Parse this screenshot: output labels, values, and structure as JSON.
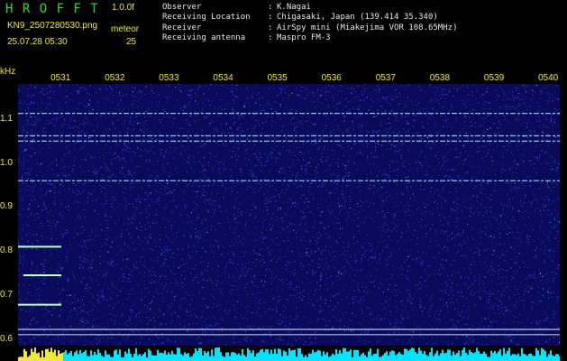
{
  "header": {
    "app_name": "H R O F F T",
    "version": "1.0.0f",
    "filename": "KN9_2507280530.png",
    "datetime": "25.07.28 05:30",
    "meteor_label": "meteor",
    "meteor_count": "25",
    "info": [
      {
        "key": "Observer",
        "value": "K.Nagai"
      },
      {
        "key": "Receiving Location",
        "value": "Chigasaki, Japan (139.414 35.340)"
      },
      {
        "key": "Receiver",
        "value": "AirSpy mini (Miakejima VOR 108.65MHz)"
      },
      {
        "key": "Receiving antenna",
        "value": "Maspro FM-3"
      }
    ]
  },
  "colors": {
    "background": "#000000",
    "plot_background": "#0a0a5a",
    "noise": "#3a5cff",
    "signal": "#9fe6ff",
    "header_green": "#3ad23a",
    "label_yellow": "#f0e83a",
    "strip_cyan": "#00e5ff"
  },
  "chart_data": {
    "type": "heatmap",
    "ylabel": "kHz",
    "y_ticks": [
      "1.1",
      "1.0",
      "0.9",
      "0.8",
      "0.7",
      "0.6"
    ],
    "x_ticks": [
      "0531",
      "0532",
      "0533",
      "0534",
      "0535",
      "0536",
      "0537",
      "0538",
      "0539",
      "0540"
    ],
    "x_range": [
      "0530",
      "0540"
    ],
    "y_range": [
      0.585,
      1.18
    ],
    "carriers_khz": [
      1.113,
      1.062,
      1.05,
      0.96,
      0.622,
      0.61
    ],
    "meteor_echoes": [
      {
        "freq_khz": 0.81,
        "start": "0530.0",
        "end": "0530.8"
      },
      {
        "freq_khz": 0.745,
        "start": "0530.1",
        "end": "0530.8"
      },
      {
        "freq_khz": 0.678,
        "start": "0530.0",
        "end": "0530.8"
      }
    ]
  }
}
